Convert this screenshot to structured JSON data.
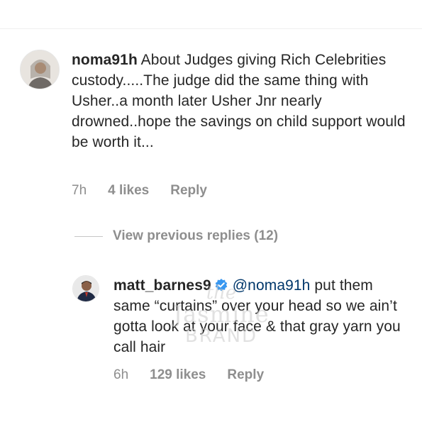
{
  "comment1": {
    "username": "noma91h",
    "text": " About Judges giving Rich Celebrities custody.....The judge did the same thing with Usher..a month later Usher Jnr nearly drowned..hope the savings on child support would be worth it...",
    "time": "7h",
    "likes": "4 likes",
    "reply": "Reply",
    "avatar_icon": "user-avatar-icon"
  },
  "view_replies": "View previous replies (12)",
  "comment2": {
    "username": "matt_barnes9",
    "verified_icon": "verified-badge-icon",
    "mention": "@noma91h",
    "text": " put them same “curtains” over your head so we ain’t gotta look at your face & that gray yarn you call hair",
    "time": "6h",
    "likes": "129 likes",
    "reply": "Reply",
    "avatar_icon": "user-avatar-icon"
  },
  "watermark": {
    "line1": "the",
    "line2": "Jasmine",
    "line3": "BRAND"
  },
  "colors": {
    "text": "#262626",
    "meta": "#8e8e8e",
    "mention": "#00376b",
    "verified": "#3897f0"
  }
}
